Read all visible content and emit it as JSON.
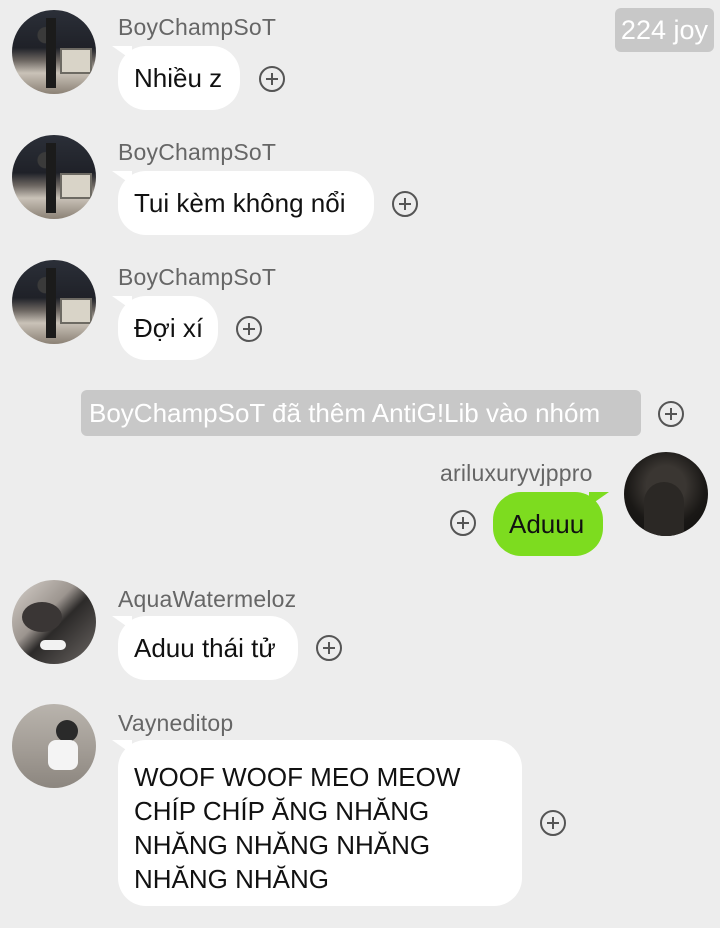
{
  "joy_counter": "224 joy",
  "messages": [
    {
      "sender": "BoyChampSoT",
      "text": "Nhiều z"
    },
    {
      "sender": "BoyChampSoT",
      "text": "Tui kèm không nổi"
    },
    {
      "sender": "BoyChampSoT",
      "text": "Đợi xí"
    },
    {
      "system": "BoyChampSoT đã thêm AntiG!Lib vào nhóm"
    },
    {
      "sender": "ariluxuryvjppro",
      "text": "Aduuu"
    },
    {
      "sender": "AquaWatermeloz",
      "text": "Aduu thái tử"
    },
    {
      "sender": "Vayneditop",
      "lines": [
        "WOOF WOOF MEO MEOW",
        "CHÍP CHÍP ĂNG NHĂNG",
        "NHĂNG NHĂNG NHĂNG",
        "NHĂNG NHĂNG"
      ]
    }
  ],
  "colors": {
    "background": "#ededed",
    "outgoing_bubble": "#7ddc1f",
    "incoming_bubble": "#ffffff",
    "system_pill": "#c8c8c8"
  }
}
